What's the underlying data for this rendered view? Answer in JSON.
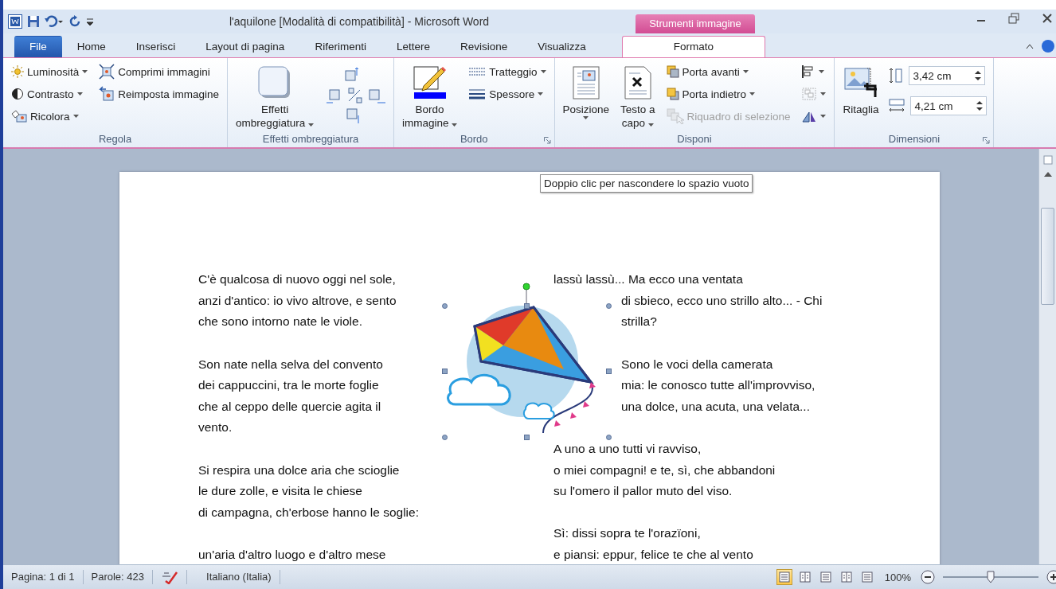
{
  "title_bar": {
    "title": "l'aquilone [Modalità di compatibilità] - Microsoft Word",
    "context_label": "Strumenti immagine"
  },
  "tabs": [
    {
      "label": "File",
      "kind": "file",
      "selected": false
    },
    {
      "label": "Home",
      "kind": "normal",
      "selected": false
    },
    {
      "label": "Inserisci",
      "kind": "normal",
      "selected": false
    },
    {
      "label": "Layout di pagina",
      "kind": "normal",
      "selected": false
    },
    {
      "label": "Riferimenti",
      "kind": "normal",
      "selected": false
    },
    {
      "label": "Lettere",
      "kind": "normal",
      "selected": false
    },
    {
      "label": "Revisione",
      "kind": "normal",
      "selected": false
    },
    {
      "label": "Visualizza",
      "kind": "normal",
      "selected": false
    },
    {
      "label": "Formato",
      "kind": "context",
      "selected": true
    }
  ],
  "ribbon": [
    {
      "title": "Regola",
      "launcher": false,
      "items": [
        {
          "kind": "column",
          "buttons": [
            {
              "label": "Luminosità",
              "dropdown": true,
              "disabled": false
            },
            {
              "label": "Contrasto",
              "dropdown": true,
              "disabled": false
            },
            {
              "label": "Ricolora",
              "dropdown": true,
              "disabled": false
            }
          ]
        },
        {
          "kind": "column",
          "buttons": [
            {
              "label": "Comprimi immagini",
              "dropdown": false,
              "disabled": false
            },
            {
              "label": "Reimposta immagine",
              "dropdown": false,
              "disabled": false
            }
          ]
        }
      ]
    },
    {
      "title": "Effetti ombreggiatura",
      "launcher": false,
      "items": [
        {
          "kind": "large",
          "lines": [
            "Effetti",
            "ombreggiatura"
          ],
          "dropdown": true
        },
        {
          "kind": "nudge"
        }
      ]
    },
    {
      "title": "Bordo",
      "launcher": true,
      "items": [
        {
          "kind": "large",
          "lines": [
            "Bordo",
            "immagine"
          ],
          "dropdown": true
        },
        {
          "kind": "column",
          "buttons": [
            {
              "label": "Tratteggio",
              "dropdown": true,
              "disabled": false
            },
            {
              "label": "Spessore",
              "dropdown": true,
              "disabled": false
            }
          ]
        }
      ]
    },
    {
      "title": "Disponi",
      "launcher": false,
      "items": [
        {
          "kind": "large",
          "lines": [
            "Posizione"
          ],
          "dropdown": true
        },
        {
          "kind": "large",
          "lines": [
            "Testo a",
            "capo"
          ],
          "dropdown": true
        },
        {
          "kind": "column",
          "buttons": [
            {
              "label": "Porta avanti",
              "dropdown": true,
              "disabled": false
            },
            {
              "label": "Porta indietro",
              "dropdown": true,
              "disabled": false
            },
            {
              "label": "Riquadro di selezione",
              "dropdown": false,
              "disabled": true
            }
          ]
        },
        {
          "kind": "icon_column",
          "buttons": [
            {
              "dropdown": true,
              "disabled": false
            },
            {
              "dropdown": true,
              "disabled": true
            },
            {
              "dropdown": true,
              "disabled": false
            }
          ]
        }
      ]
    },
    {
      "title": "Dimensioni",
      "launcher": true,
      "items": [
        {
          "kind": "large",
          "lines": [
            "Ritaglia"
          ],
          "dropdown": false
        },
        {
          "kind": "spin_column",
          "fields": [
            {
              "value": "3,42 cm"
            },
            {
              "value": "4,21 cm"
            }
          ]
        }
      ]
    }
  ],
  "document": {
    "tooltip": "Doppio clic per nascondere lo spazio vuoto",
    "image": {
      "selected": true
    },
    "left_column": [
      [
        "C'è qualcosa di nuovo oggi nel sole,",
        "anzi d'antico: io vivo altrove, e sento",
        "che sono intorno nate le viole."
      ],
      [
        "Son nate nella selva del convento",
        "dei cappuccini, tra le morte foglie",
        "che al ceppo delle quercie agita il",
        "vento."
      ],
      [
        "Si respira una dolce aria che scioglie",
        "le dure zolle, e visita le chiese",
        "di campagna, ch'erbose hanno le soglie:"
      ],
      [
        "un'aria d'altro luogo e d'altro mese"
      ]
    ],
    "right_column": [
      [
        "lassù lassù... Ma ecco una ventata",
        "di sbieco, ecco uno strillo alto... - Chi",
        "strilla?"
      ],
      [
        "Sono le voci della camerata",
        "mia: le conosco tutte all'improvviso,",
        "una dolce, una acuta, una velata..."
      ],
      [
        "A uno a uno tutti vi ravviso,",
        "o miei compagni! e te, sì, che abbandoni",
        "su l'omero il pallor muto del viso."
      ],
      [
        "Sì: dissi sopra te l'orazïoni,",
        "e piansi: eppur, felice te che al vento"
      ]
    ]
  },
  "status_bar": {
    "page": "Pagina: 1 di 1",
    "words": "Parole: 423",
    "language": "Italiano (Italia)",
    "views": [
      {
        "selected": true
      },
      {
        "selected": false
      },
      {
        "selected": false
      },
      {
        "selected": false
      },
      {
        "selected": false
      }
    ],
    "zoom": "100%",
    "zoom_slider": {
      "level": 0.5
    }
  }
}
